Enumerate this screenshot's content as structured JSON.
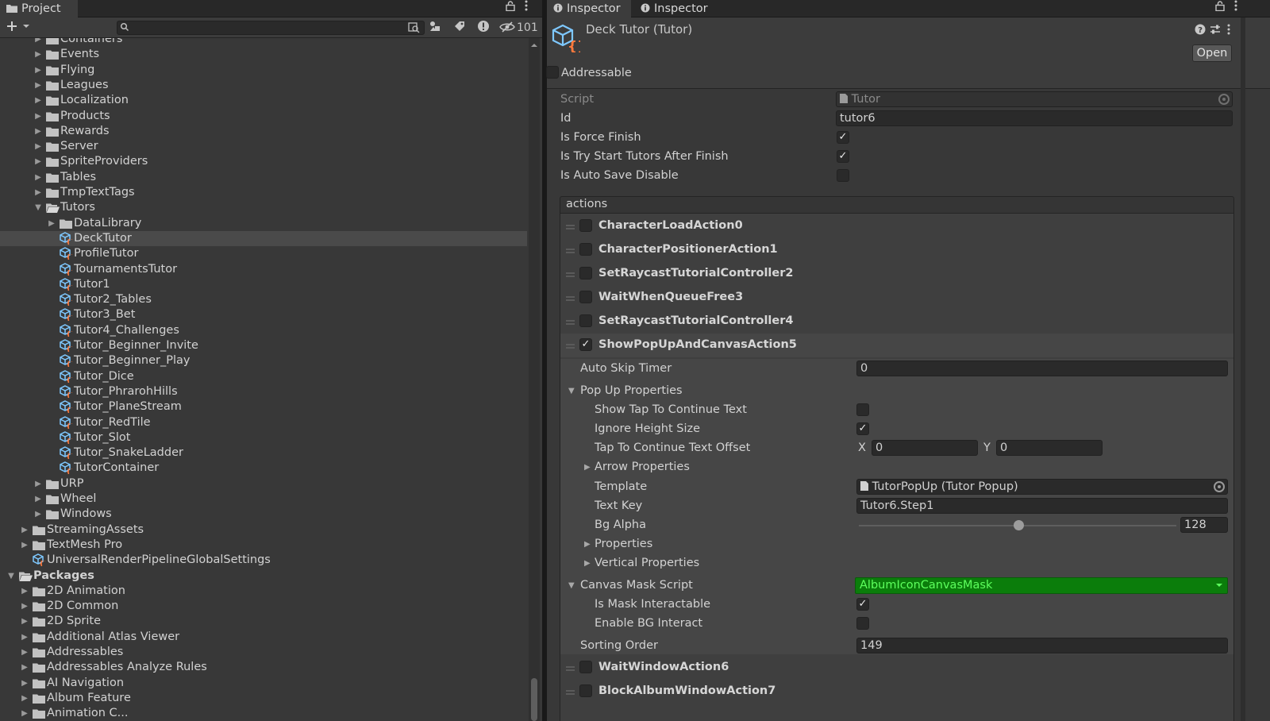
{
  "project": {
    "tab_label": "Project",
    "hidden_count": "101",
    "search": {
      "placeholder": ""
    },
    "tree": [
      {
        "label": "Containers",
        "depth": 2,
        "type": "folder",
        "expanded": false
      },
      {
        "label": "Events",
        "depth": 2,
        "type": "folder",
        "expanded": false
      },
      {
        "label": "Flying",
        "depth": 2,
        "type": "folder",
        "expanded": false
      },
      {
        "label": "Leagues",
        "depth": 2,
        "type": "folder",
        "expanded": false
      },
      {
        "label": "Localization",
        "depth": 2,
        "type": "folder",
        "expanded": false
      },
      {
        "label": "Products",
        "depth": 2,
        "type": "folder",
        "expanded": false
      },
      {
        "label": "Rewards",
        "depth": 2,
        "type": "folder",
        "expanded": false
      },
      {
        "label": "Server",
        "depth": 2,
        "type": "folder",
        "expanded": false
      },
      {
        "label": "SpriteProviders",
        "depth": 2,
        "type": "folder",
        "expanded": false
      },
      {
        "label": "Tables",
        "depth": 2,
        "type": "folder",
        "expanded": false
      },
      {
        "label": "TmpTextTags",
        "depth": 2,
        "type": "folder",
        "expanded": false
      },
      {
        "label": "Tutors",
        "depth": 2,
        "type": "folder-open",
        "expanded": true
      },
      {
        "label": "DataLibrary",
        "depth": 3,
        "type": "folder",
        "expanded": false
      },
      {
        "label": "DeckTutor",
        "depth": 3,
        "type": "asset",
        "selected": true
      },
      {
        "label": "ProfileTutor",
        "depth": 3,
        "type": "asset"
      },
      {
        "label": "TournamentsTutor",
        "depth": 3,
        "type": "asset"
      },
      {
        "label": "Tutor1",
        "depth": 3,
        "type": "asset"
      },
      {
        "label": "Tutor2_Tables",
        "depth": 3,
        "type": "asset"
      },
      {
        "label": "Tutor3_Bet",
        "depth": 3,
        "type": "asset"
      },
      {
        "label": "Tutor4_Challenges",
        "depth": 3,
        "type": "asset"
      },
      {
        "label": "Tutor_Beginner_Invite",
        "depth": 3,
        "type": "asset"
      },
      {
        "label": "Tutor_Beginner_Play",
        "depth": 3,
        "type": "asset"
      },
      {
        "label": "Tutor_Dice",
        "depth": 3,
        "type": "asset"
      },
      {
        "label": "Tutor_PhrarohHills",
        "depth": 3,
        "type": "asset"
      },
      {
        "label": "Tutor_PlaneStream",
        "depth": 3,
        "type": "asset"
      },
      {
        "label": "Tutor_RedTile",
        "depth": 3,
        "type": "asset"
      },
      {
        "label": "Tutor_Slot",
        "depth": 3,
        "type": "asset"
      },
      {
        "label": "Tutor_SnakeLadder",
        "depth": 3,
        "type": "asset"
      },
      {
        "label": "TutorContainer",
        "depth": 3,
        "type": "asset"
      },
      {
        "label": "URP",
        "depth": 2,
        "type": "folder",
        "expanded": false
      },
      {
        "label": "Wheel",
        "depth": 2,
        "type": "folder",
        "expanded": false
      },
      {
        "label": "Windows",
        "depth": 2,
        "type": "folder",
        "expanded": false
      },
      {
        "label": "StreamingAssets",
        "depth": 1,
        "type": "folder",
        "expanded": false
      },
      {
        "label": "TextMesh Pro",
        "depth": 1,
        "type": "folder",
        "expanded": false
      },
      {
        "label": "UniversalRenderPipelineGlobalSettings",
        "depth": 1,
        "type": "asset-noarrow"
      },
      {
        "label": "Packages",
        "depth": 0,
        "type": "folder-open",
        "expanded": true,
        "bold": true
      },
      {
        "label": "2D Animation",
        "depth": 1,
        "type": "folder",
        "expanded": false
      },
      {
        "label": "2D Common",
        "depth": 1,
        "type": "folder",
        "expanded": false
      },
      {
        "label": "2D Sprite",
        "depth": 1,
        "type": "folder",
        "expanded": false
      },
      {
        "label": "Additional Atlas Viewer",
        "depth": 1,
        "type": "folder",
        "expanded": false
      },
      {
        "label": "Addressables",
        "depth": 1,
        "type": "folder",
        "expanded": false
      },
      {
        "label": "Addressables Analyze Rules",
        "depth": 1,
        "type": "folder",
        "expanded": false
      },
      {
        "label": "AI Navigation",
        "depth": 1,
        "type": "folder",
        "expanded": false
      },
      {
        "label": "Album Feature",
        "depth": 1,
        "type": "folder",
        "expanded": false
      },
      {
        "label": "Animation C...",
        "depth": 1,
        "type": "folder",
        "expanded": false
      }
    ]
  },
  "inspector": {
    "tabs": [
      "Inspector",
      "Inspector"
    ],
    "title": "Deck Tutor (Tutor)",
    "open_label": "Open",
    "addressable_label": "Addressable",
    "addressable_checked": false,
    "script_label": "Script",
    "script_value": "Tutor",
    "id_label": "Id",
    "id_value": "tutor6",
    "force_finish_label": "Is Force Finish",
    "force_finish": true,
    "try_start_label": "Is Try Start Tutors After Finish",
    "try_start": true,
    "auto_save_label": "Is Auto Save Disable",
    "auto_save": false,
    "actions_header": "actions",
    "actions": [
      {
        "name": "CharacterLoadAction0",
        "checked": false
      },
      {
        "name": "CharacterPositionerAction1",
        "checked": false
      },
      {
        "name": "SetRaycastTutorialController2",
        "checked": false
      },
      {
        "name": "WaitWhenQueueFree3",
        "checked": false
      },
      {
        "name": "SetRaycastTutorialController4",
        "checked": false
      },
      {
        "name": "ShowPopUpAndCanvasAction5",
        "checked": true
      }
    ],
    "expanded": {
      "auto_skip_label": "Auto Skip Timer",
      "auto_skip_value": "0",
      "popup_props_label": "Pop Up Properties",
      "show_tap_label": "Show Tap To Continue Text",
      "show_tap": false,
      "ignore_height_label": "Ignore Height Size",
      "ignore_height": true,
      "tap_offset_label": "Tap To Continue Text Offset",
      "x_label": "X",
      "x_value": "0",
      "y_label": "Y",
      "y_value": "0",
      "arrow_props_label": "Arrow Properties",
      "template_label": "Template",
      "template_value": "TutorPopUp (Tutor Popup)",
      "text_key_label": "Text Key",
      "text_key_value": "Tutor6.Step1",
      "bg_alpha_label": "Bg Alpha",
      "bg_alpha_value": "128",
      "bg_alpha_fraction": 0.502,
      "properties_label": "Properties",
      "vertical_props_label": "Vertical Properties",
      "canvas_mask_label": "Canvas Mask Script",
      "canvas_mask_value": "AlbumIconCanvasMask",
      "mask_interactable_label": "Is Mask Interactable",
      "mask_interactable": true,
      "enable_bg_label": "Enable BG Interact",
      "enable_bg": false,
      "sorting_order_label": "Sorting Order",
      "sorting_order_value": "149"
    },
    "actions_after": [
      {
        "name": "WaitWindowAction6",
        "checked": false
      },
      {
        "name": "BlockAlbumWindowAction7",
        "checked": false
      }
    ],
    "colors": {
      "green_dropdown": "#0b7d0b",
      "green_text": "#5dff5d",
      "selection": "#4a4a4a"
    }
  }
}
